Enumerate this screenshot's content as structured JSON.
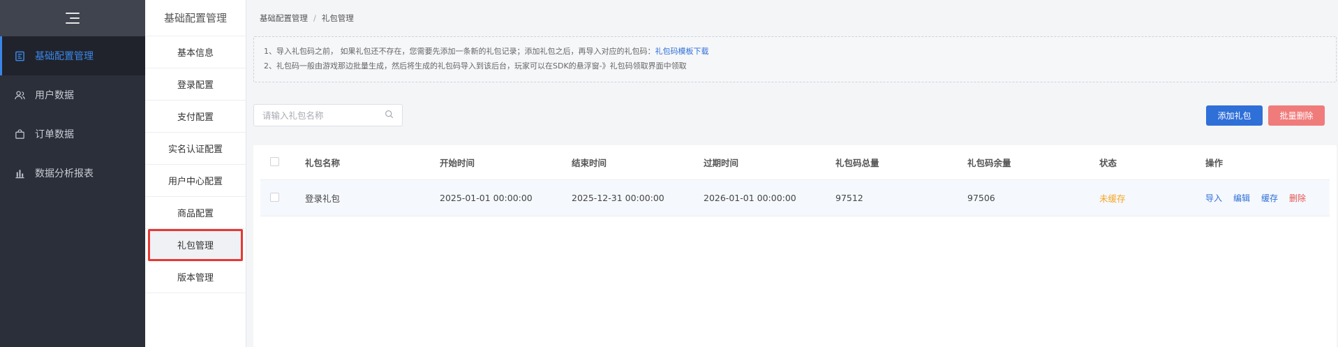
{
  "sidebar": {
    "items": [
      {
        "label": "基础配置管理",
        "icon": "config-icon",
        "active": true
      },
      {
        "label": "用户数据",
        "icon": "users-icon",
        "active": false
      },
      {
        "label": "订单数据",
        "icon": "order-bag-icon",
        "active": false
      },
      {
        "label": "数据分析报表",
        "icon": "bar-chart-icon",
        "active": false
      }
    ]
  },
  "subnav": {
    "title": "基础配置管理",
    "items": [
      "基本信息",
      "登录配置",
      "支付配置",
      "实名认证配置",
      "用户中心配置",
      "商品配置",
      "礼包管理",
      "版本管理"
    ],
    "active_index": 6
  },
  "breadcrumb": {
    "parent": "基础配置管理",
    "separator": "/",
    "current": "礼包管理"
  },
  "notice": {
    "line1": "1、导入礼包码之前， 如果礼包还不存在，您需要先添加一条新的礼包记录；添加礼包之后，再导入对应的礼包码：",
    "line1_link": "礼包码模板下载",
    "line2": "2、礼包码一般由游戏那边批量生成，然后将生成的礼包码导入到该后台，玩家可以在SDK的悬浮窗-》礼包码领取界面中领取"
  },
  "search": {
    "placeholder": "请输入礼包名称"
  },
  "toolbar": {
    "add_label": "添加礼包",
    "batch_delete_label": "批量删除"
  },
  "table": {
    "headers": [
      "礼包名称",
      "开始时间",
      "结束时间",
      "过期时间",
      "礼包码总量",
      "礼包码余量",
      "状态",
      "操作"
    ],
    "rows": [
      {
        "name": "登录礼包",
        "start": "2025-01-01 00:00:00",
        "end": "2025-12-31 00:00:00",
        "expire": "2026-01-01 00:00:00",
        "total": "97512",
        "remaining": "97506",
        "status": "未缓存",
        "actions": [
          "导入",
          "编辑",
          "缓存",
          "删除"
        ]
      }
    ]
  },
  "colors": {
    "accent": "#2f6fd8",
    "danger": "#e5544f",
    "warning": "#f5a623",
    "sidebar_bg": "#2b2f3a"
  }
}
